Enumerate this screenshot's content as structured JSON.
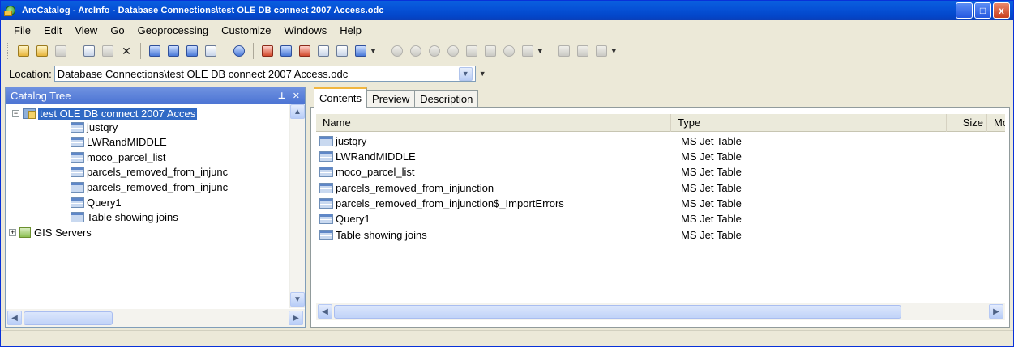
{
  "window": {
    "title": "ArcCatalog - ArcInfo - Database Connections\\test OLE DB connect 2007 Access.odc",
    "controls": [
      "_",
      "□",
      "x"
    ]
  },
  "menu": [
    "File",
    "Edit",
    "View",
    "Go",
    "Geoprocessing",
    "Customize",
    "Windows",
    "Help"
  ],
  "location": {
    "label": "Location:",
    "value": "Database Connections\\test OLE DB connect 2007 Access.odc"
  },
  "catalog_tree": {
    "title": "Catalog Tree",
    "root": {
      "label": "test OLE DB connect 2007 Acces",
      "expander": "⊟"
    },
    "items": [
      "justqry",
      "LWRandMIDDLE",
      "moco_parcel_list",
      "parcels_removed_from_injunc",
      "parcels_removed_from_injunc",
      "Query1",
      "Table showing joins"
    ],
    "servers": {
      "label": "GIS Servers",
      "expander": "⊞"
    }
  },
  "tabs": [
    "Contents",
    "Preview",
    "Description"
  ],
  "columns": [
    "Name",
    "Type",
    "Size",
    "Modifie"
  ],
  "rows": [
    {
      "name": "justqry",
      "type": "MS Jet Table"
    },
    {
      "name": "LWRandMIDDLE",
      "type": "MS Jet Table"
    },
    {
      "name": "moco_parcel_list",
      "type": "MS Jet Table"
    },
    {
      "name": "parcels_removed_from_injunction",
      "type": "MS Jet Table"
    },
    {
      "name": "parcels_removed_from_injunction$_ImportErrors",
      "type": "MS Jet Table"
    },
    {
      "name": "Query1",
      "type": "MS Jet Table"
    },
    {
      "name": "Table showing joins",
      "type": "MS Jet Table"
    }
  ],
  "colors": {
    "selection": "#316ac5",
    "titlebar": "#0a5fdf",
    "pane_title": "#6f92e0"
  }
}
